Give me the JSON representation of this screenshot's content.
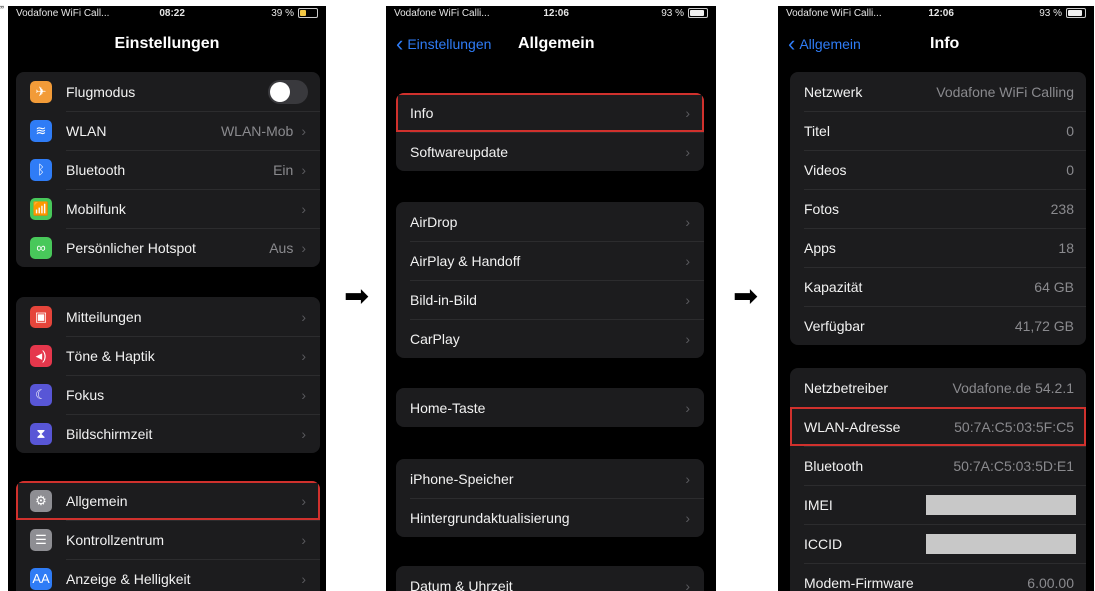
{
  "header_quote": "„",
  "flow_arrow": "➡",
  "screen1": {
    "status": {
      "carrier": "Vodafone WiFi Call...",
      "time": "08:22",
      "battery": "39 %"
    },
    "title": "Einstellungen",
    "groups": [
      [
        {
          "label": "Flugmodus",
          "icon": "airplane-icon",
          "icon_glyph": "✈",
          "color": "#f29b38",
          "toggle": true
        },
        {
          "label": "WLAN",
          "icon": "wifi-icon",
          "icon_glyph": "≋",
          "color": "#2f7cf6",
          "value": "WLAN-Mob"
        },
        {
          "label": "Bluetooth",
          "icon": "bluetooth-icon",
          "icon_glyph": "ᛒ",
          "color": "#2f7cf6",
          "value": "Ein"
        },
        {
          "label": "Mobilfunk",
          "icon": "antenna-icon",
          "icon_glyph": "📶",
          "color": "#48c85a",
          "value": ""
        },
        {
          "label": "Persönlicher Hotspot",
          "icon": "hotspot-icon",
          "icon_glyph": "∞",
          "color": "#48c85a",
          "value": "Aus"
        }
      ],
      [
        {
          "label": "Mitteilungen",
          "icon": "notifications-icon",
          "icon_glyph": "▣",
          "color": "#e5453b",
          "value": ""
        },
        {
          "label": "Töne & Haptik",
          "icon": "speaker-icon",
          "icon_glyph": "◂)",
          "color": "#e5374c",
          "value": ""
        },
        {
          "label": "Fokus",
          "icon": "moon-icon",
          "icon_glyph": "☾",
          "color": "#5856d6",
          "value": ""
        },
        {
          "label": "Bildschirmzeit",
          "icon": "hourglass-icon",
          "icon_glyph": "⧗",
          "color": "#5856d6",
          "value": ""
        }
      ],
      [
        {
          "label": "Allgemein",
          "icon": "gear-icon",
          "icon_glyph": "⚙",
          "color": "#8e8e93",
          "value": "",
          "highlight": true
        },
        {
          "label": "Kontrollzentrum",
          "icon": "switches-icon",
          "icon_glyph": "☰",
          "color": "#8e8e93",
          "value": ""
        },
        {
          "label": "Anzeige & Helligkeit",
          "icon": "text-size-icon",
          "icon_glyph": "AA",
          "color": "#2f7cf6",
          "value": ""
        }
      ]
    ]
  },
  "screen2": {
    "status": {
      "carrier": "Vodafone WiFi Calli...",
      "time": "12:06",
      "battery": "93 %"
    },
    "back_label": "Einstellungen",
    "title": "Allgemein",
    "groups": [
      [
        {
          "label": "Info",
          "highlight": true
        },
        {
          "label": "Softwareupdate"
        }
      ],
      [
        {
          "label": "AirDrop"
        },
        {
          "label": "AirPlay & Handoff"
        },
        {
          "label": "Bild-in-Bild"
        },
        {
          "label": "CarPlay"
        }
      ],
      [
        {
          "label": "Home-Taste"
        }
      ],
      [
        {
          "label": "iPhone-Speicher"
        },
        {
          "label": "Hintergrundaktualisierung"
        }
      ],
      [
        {
          "label": "Datum & Uhrzeit"
        }
      ]
    ]
  },
  "screen3": {
    "status": {
      "carrier": "Vodafone WiFi Calli...",
      "time": "12:06",
      "battery": "93 %"
    },
    "back_label": "Allgemein",
    "title": "Info",
    "groups": [
      [
        {
          "label": "Netzwerk",
          "value": "Vodafone WiFi Calling"
        },
        {
          "label": "Titel",
          "value": "0"
        },
        {
          "label": "Videos",
          "value": "0"
        },
        {
          "label": "Fotos",
          "value": "238"
        },
        {
          "label": "Apps",
          "value": "18"
        },
        {
          "label": "Kapazität",
          "value": "64 GB"
        },
        {
          "label": "Verfügbar",
          "value": "41,72 GB"
        }
      ],
      [
        {
          "label": "Netzbetreiber",
          "value": "Vodafone.de 54.2.1"
        },
        {
          "label": "WLAN-Adresse",
          "value": "50:7A:C5:03:5F:C5",
          "highlight": true
        },
        {
          "label": "Bluetooth",
          "value": "50:7A:C5:03:5D:E1"
        },
        {
          "label": "IMEI",
          "value": "",
          "redacted": true
        },
        {
          "label": "ICCID",
          "value": "",
          "redacted": true
        },
        {
          "label": "Modem-Firmware",
          "value": "6.00.00"
        }
      ]
    ]
  }
}
